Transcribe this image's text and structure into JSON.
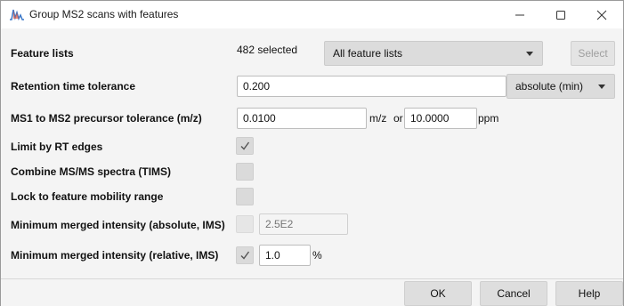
{
  "window": {
    "title": "Group MS2 scans with features",
    "controls": {
      "minimize_icon": "minimize-icon",
      "maximize_icon": "maximize-icon",
      "close_icon": "close-icon"
    }
  },
  "feature_lists": {
    "label": "Feature lists",
    "count_text": "482 selected",
    "selected": "All feature lists",
    "select_button": "Select"
  },
  "rt_tolerance": {
    "label": "Retention time tolerance",
    "value": "0.200",
    "unit_selected": "absolute (min)"
  },
  "precursor_tolerance": {
    "label": "MS1 to MS2 precursor tolerance (m/z)",
    "mz_value": "0.0100",
    "mz_unit": "m/z",
    "or_text": "or",
    "ppm_value": "10.0000",
    "ppm_unit": "ppm"
  },
  "limit_rt_edges": {
    "label": "Limit by RT edges",
    "checked": true
  },
  "combine_tims": {
    "label": "Combine MS/MS spectra (TIMS)",
    "checked": false
  },
  "lock_mobility": {
    "label": "Lock to feature mobility range",
    "checked": false
  },
  "min_abs_intensity": {
    "label": "Minimum merged intensity (absolute, IMS)",
    "checked": false,
    "placeholder": "2.5E2"
  },
  "min_rel_intensity": {
    "label": "Minimum merged intensity (relative, IMS)",
    "checked": true,
    "value": "1.0",
    "unit": "%"
  },
  "footer": {
    "ok": "OK",
    "cancel": "Cancel",
    "help": "Help"
  },
  "colors": {
    "checkmark": "#555555",
    "app_icon_blue": "#3b78c9"
  }
}
